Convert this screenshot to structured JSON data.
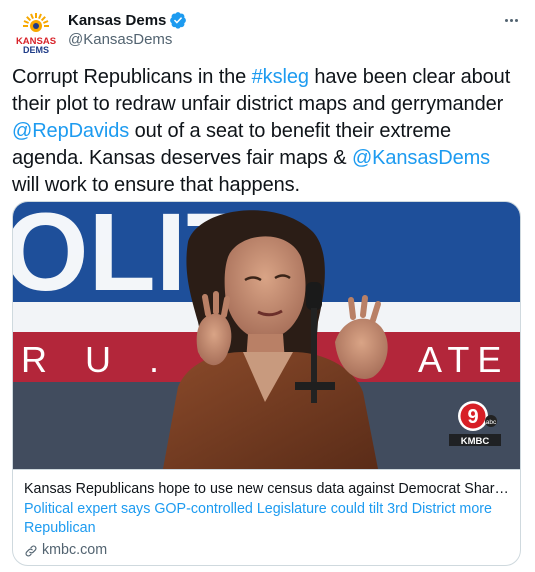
{
  "account": {
    "display_name": "Kansas Dems",
    "handle": "@KansasDems",
    "avatar_text_line1": "KANSAS",
    "avatar_text_line2": "DEMS",
    "verified": true
  },
  "tweet": {
    "segments": [
      {
        "text": "Corrupt Republicans in the ",
        "link": false
      },
      {
        "text": "#ksleg",
        "link": true
      },
      {
        "text": " have been clear about their plot to redraw unfair district maps and gerrymander ",
        "link": false
      },
      {
        "text": "@RepDavids",
        "link": true
      },
      {
        "text": " out of a seat to benefit their extreme agenda. Kansas deserves fair maps & ",
        "link": false
      },
      {
        "text": "@KansasDems",
        "link": true
      },
      {
        "text": " will work to ensure that happens.",
        "link": false
      }
    ]
  },
  "card": {
    "title": "Kansas Republicans hope to use new census data against Democrat Sharic...",
    "description": "Political expert says GOP-controlled Legislature could tilt 3rd District more Republican",
    "domain": "kmbc.com",
    "image": {
      "backdrop_letters_top": "OLIT",
      "backdrop_letters_bottom": "R U . S .",
      "backdrop_letters_bottom_right": "ATE",
      "station_badge": "KMBC",
      "channel": "9",
      "network": "abc"
    }
  },
  "colors": {
    "link": "#1d9bf0",
    "text": "#0f1419",
    "secondary": "#536471",
    "border": "#cfd9de",
    "verified": "#1d9bf0"
  },
  "icons": [
    "verified-badge-icon",
    "more-options-icon",
    "link-icon"
  ]
}
